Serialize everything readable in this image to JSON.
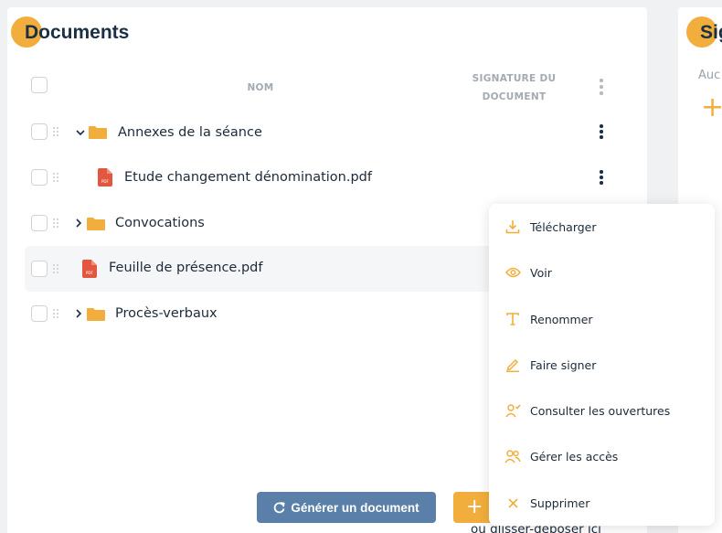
{
  "documents_panel": {
    "title": "Documents",
    "header": {
      "name_col": "NOM",
      "signature_col_line1": "SIGNATURE DU",
      "signature_col_line2": "DOCUMENT"
    },
    "rows": [
      {
        "type": "folder",
        "label": "Annexes de la séance",
        "expanded": true
      },
      {
        "type": "pdf",
        "label": "Etude changement dénomination.pdf"
      },
      {
        "type": "folder",
        "label": "Convocations",
        "expanded": false
      },
      {
        "type": "pdf",
        "label": "Feuille de présence.pdf"
      },
      {
        "type": "folder",
        "label": "Procès-verbaux",
        "expanded": false
      }
    ],
    "generate_button": "Générer un document",
    "add_button": "+",
    "drop_hint": "ou glisser-déposer ici"
  },
  "right_panel": {
    "title": "Sig",
    "text": "Auc",
    "add_icon": "plus-icon"
  },
  "context_menu": {
    "items": [
      {
        "label": "Télécharger",
        "icon": "download-icon"
      },
      {
        "label": "Voir",
        "icon": "eye-icon"
      },
      {
        "label": "Renommer",
        "icon": "text-icon"
      },
      {
        "label": "Faire signer",
        "icon": "pen-icon"
      },
      {
        "label": "Consulter les ouvertures",
        "icon": "user-check-icon"
      },
      {
        "label": "Gérer les accès",
        "icon": "users-icon"
      },
      {
        "label": "Supprimer",
        "icon": "close-icon"
      }
    ]
  },
  "colors": {
    "accent": "#f1ae3c",
    "pdf_red": "#e2573f",
    "primary_button": "#5a7fa8",
    "text": "#1d2a3a"
  }
}
